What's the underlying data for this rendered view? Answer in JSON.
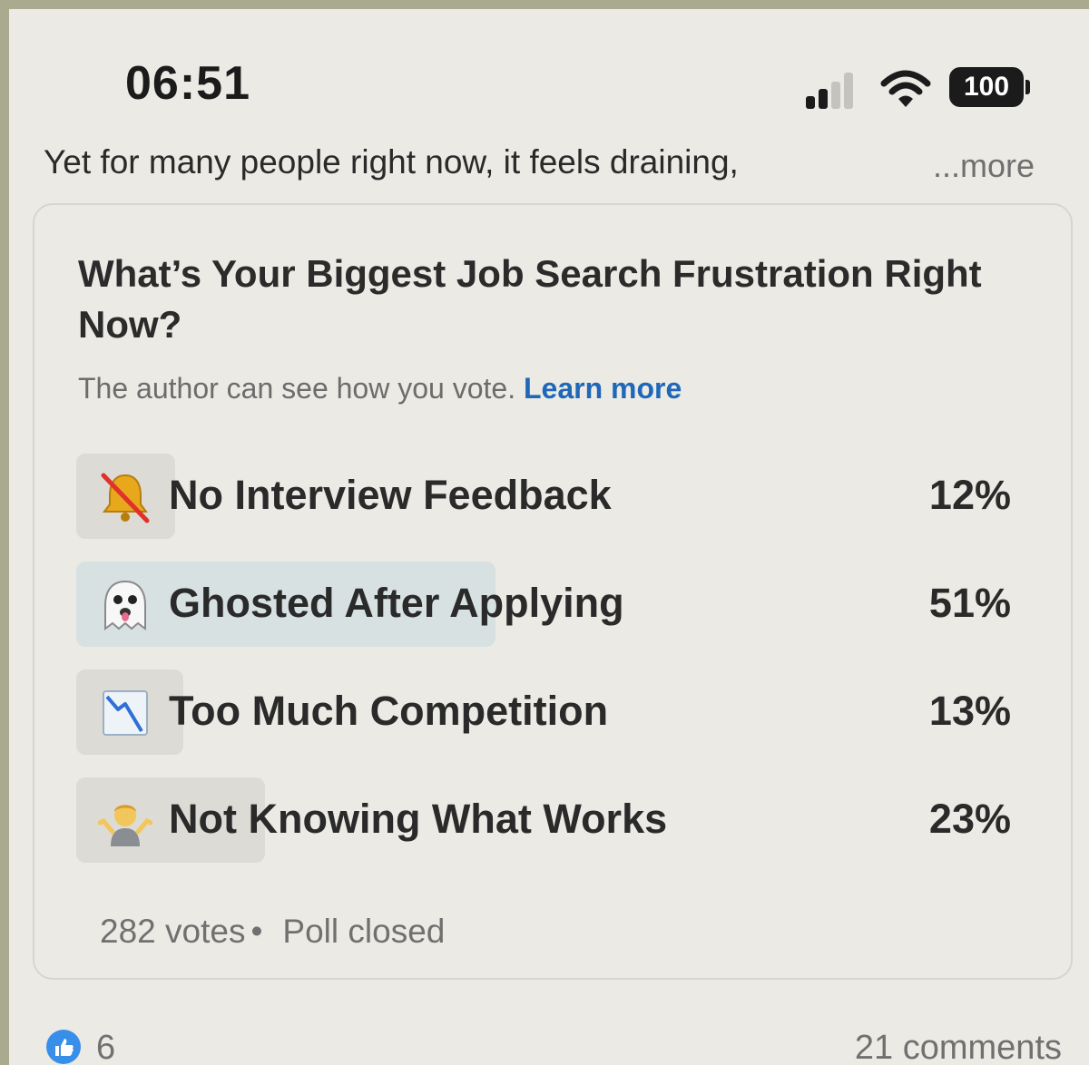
{
  "status_bar": {
    "time": "06:51",
    "battery": "100",
    "signal_icon": "cellular-signal-icon",
    "wifi_icon": "wifi-icon"
  },
  "post": {
    "teaser": "Yet for many people right now, it feels draining,",
    "more_label": "...more"
  },
  "poll": {
    "title": "What’s Your Biggest Job Search Frustration Right Now?",
    "privacy_note": "The author can see how you vote.",
    "learn_more": "Learn more",
    "options": [
      {
        "icon": "no-bell-emoji-icon",
        "label": "No Interview Feedback",
        "percent": "12%",
        "fraction": 0.12,
        "selected": false
      },
      {
        "icon": "ghost-emoji-icon",
        "label": "Ghosted After Applying",
        "percent": "51%",
        "fraction": 0.51,
        "selected": true
      },
      {
        "icon": "chart-decreasing-emoji-icon",
        "label": "Too Much Competition",
        "percent": "13%",
        "fraction": 0.13,
        "selected": false
      },
      {
        "icon": "person-shrugging-emoji-icon",
        "label": "Not Knowing What Works",
        "percent": "23%",
        "fraction": 0.23,
        "selected": false
      }
    ],
    "votes": "282 votes",
    "separator": "•",
    "status": "Poll closed"
  },
  "footer": {
    "reaction_icon": "like-icon",
    "reaction_count": "6",
    "comments": "21 comments"
  },
  "colors": {
    "background": "#eceae4",
    "link": "#1f67b7",
    "selected_bar": "#d7e1e1",
    "bar": "#dddbd5",
    "like_blue": "#378fe9"
  }
}
